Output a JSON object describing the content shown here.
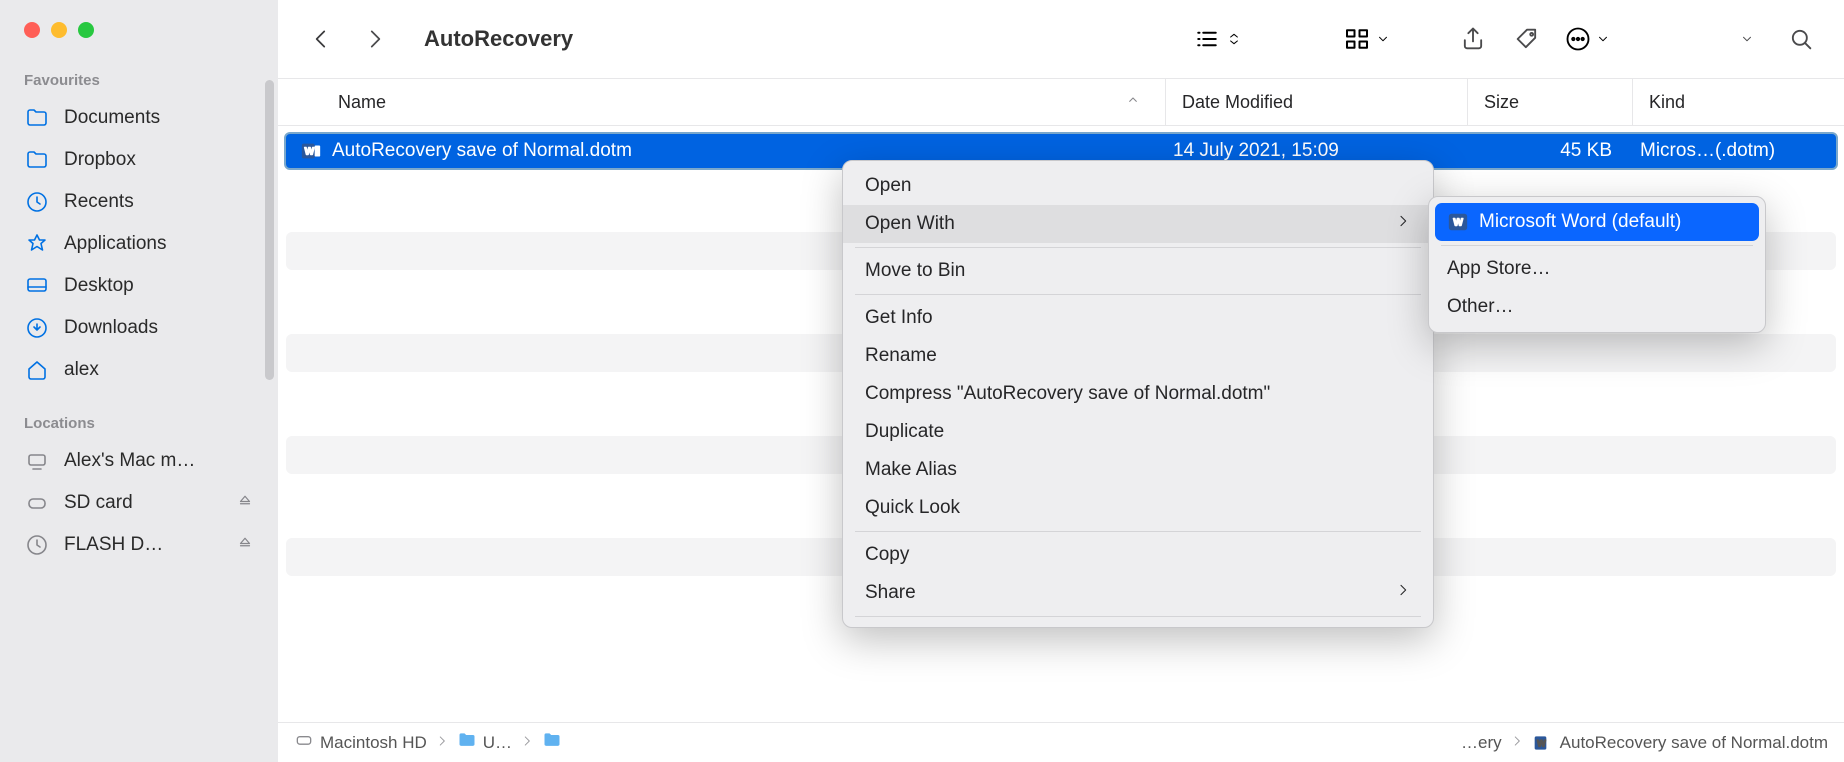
{
  "sidebar": {
    "sections": {
      "favourites": {
        "label": "Favourites",
        "items": [
          {
            "label": "Documents"
          },
          {
            "label": "Dropbox"
          },
          {
            "label": "Recents"
          },
          {
            "label": "Applications"
          },
          {
            "label": "Desktop"
          },
          {
            "label": "Downloads"
          },
          {
            "label": "alex"
          }
        ]
      },
      "locations": {
        "label": "Locations",
        "items": [
          {
            "label": "Alex's Mac m…"
          },
          {
            "label": "SD card"
          },
          {
            "label": "FLASH D…"
          }
        ]
      }
    }
  },
  "toolbar": {
    "title": "AutoRecovery"
  },
  "columns": {
    "name": "Name",
    "date": "Date Modified",
    "size": "Size",
    "kind": "Kind"
  },
  "file": {
    "name": "AutoRecovery save of Normal.dotm",
    "date": "14 July 2021, 15:09",
    "size": "45 KB",
    "kind": "Micros…(.dotm)"
  },
  "context_menu": {
    "open": "Open",
    "open_with": "Open With",
    "move_to_bin": "Move to Bin",
    "get_info": "Get Info",
    "rename": "Rename",
    "compress": "Compress \"AutoRecovery save of Normal.dotm\"",
    "duplicate": "Duplicate",
    "make_alias": "Make Alias",
    "quick_look": "Quick Look",
    "copy": "Copy",
    "share": "Share"
  },
  "submenu": {
    "word": "Microsoft Word (default)",
    "appstore": "App Store…",
    "other": "Other…"
  },
  "pathbar": {
    "seg0": "Macintosh HD",
    "seg1": "U…",
    "truncated_end": "…ery",
    "file": "AutoRecovery save of Normal.dotm"
  }
}
